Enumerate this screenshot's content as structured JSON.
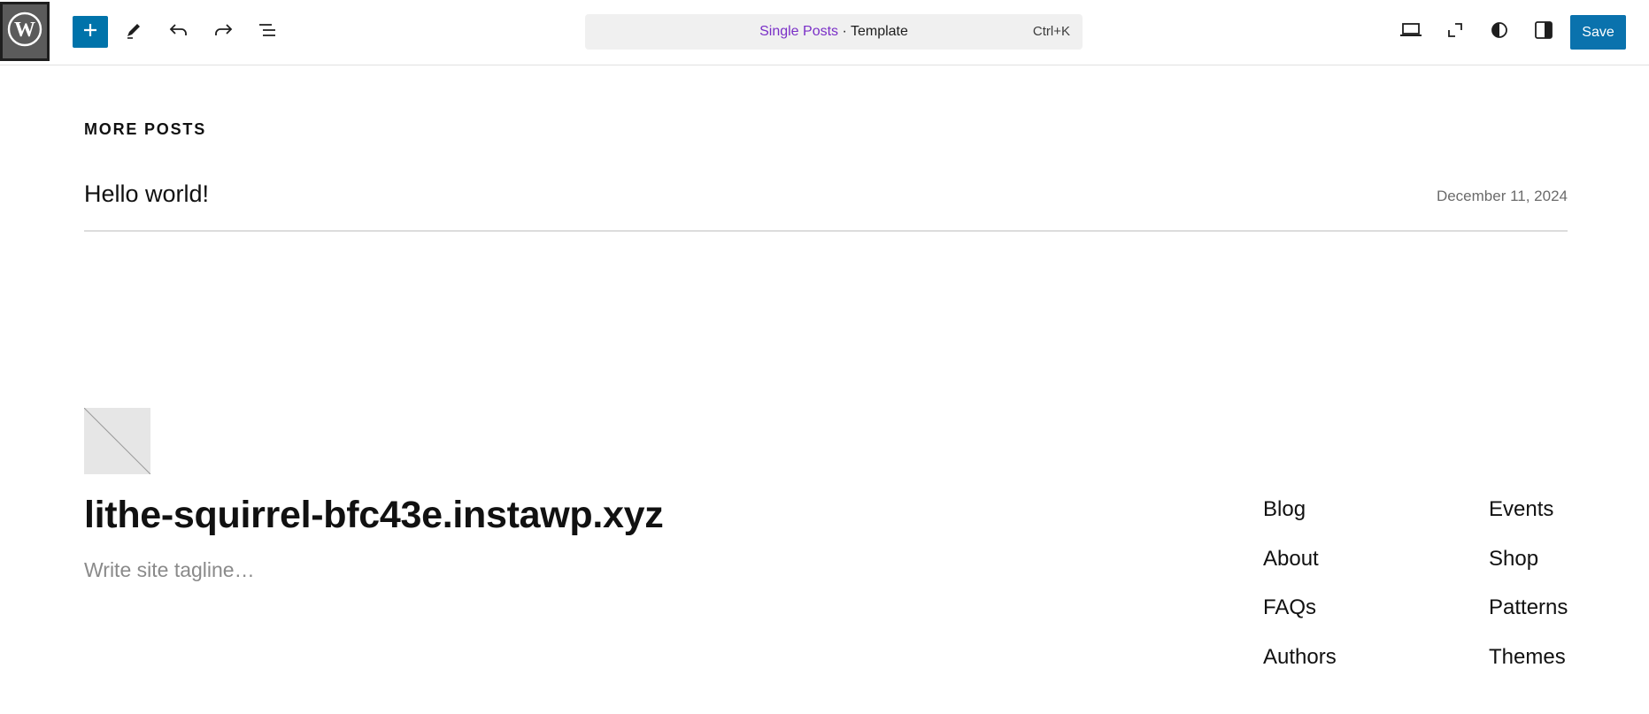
{
  "toolbar": {
    "logo_icon": "wordpress-icon",
    "add_icon": "plus-icon",
    "tool_icons": [
      "pencil-icon",
      "undo-icon",
      "redo-icon",
      "list-view-icon"
    ],
    "command_bar": {
      "post_type": "Single Posts",
      "separator": " · ",
      "template_label": "Template",
      "shortcut": "Ctrl+K"
    },
    "right_icons": [
      "desktop-view-icon",
      "fullscreen-icon",
      "styles-contrast-icon",
      "sidebar-toggle-icon"
    ],
    "save_label": "Save",
    "accent_color": "#0073aa"
  },
  "content": {
    "heading": "MORE POSTS",
    "posts": [
      {
        "title": "Hello world!",
        "date": "December 11, 2024"
      }
    ]
  },
  "footer": {
    "site_title": "lithe-squirrel-bfc43e.instawp.xyz",
    "tagline_placeholder": "Write site tagline…",
    "links_col1": [
      "Blog",
      "About",
      "FAQs",
      "Authors"
    ],
    "links_col2": [
      "Events",
      "Shop",
      "Patterns",
      "Themes"
    ]
  }
}
